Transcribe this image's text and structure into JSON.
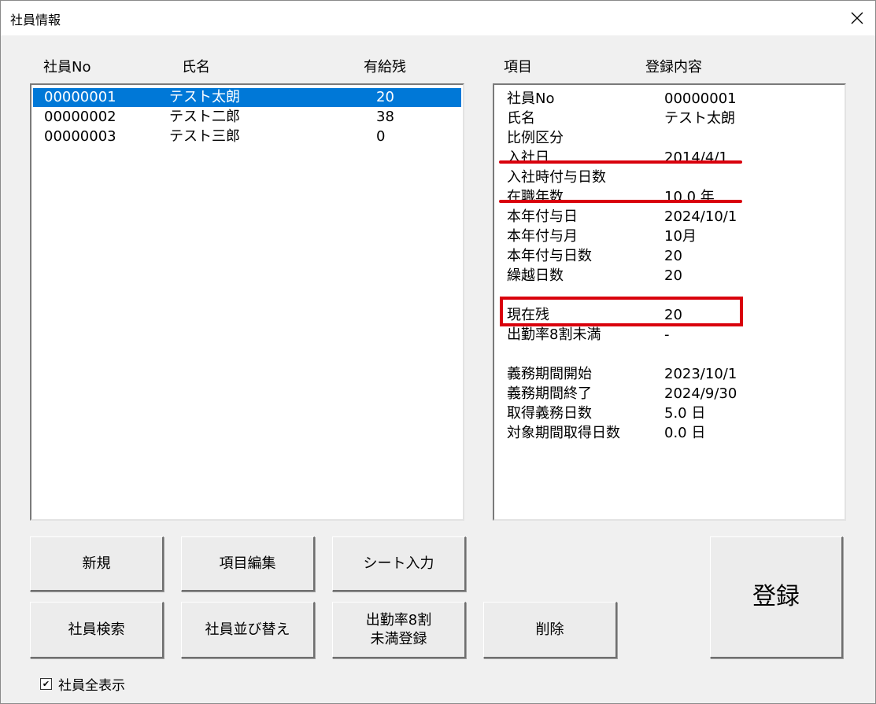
{
  "window": {
    "title": "社員情報"
  },
  "list": {
    "headers": {
      "no": "社員No",
      "name": "氏名",
      "remaining": "有給残"
    },
    "rows": [
      {
        "no": "00000001",
        "name": "テスト太朗",
        "remaining": "20",
        "selected": true
      },
      {
        "no": "00000002",
        "name": "テスト二郎",
        "remaining": "38"
      },
      {
        "no": "00000003",
        "name": "テスト三郎",
        "remaining": "0"
      }
    ]
  },
  "detail": {
    "headers": {
      "item": "項目",
      "content": "登録内容"
    },
    "rows": [
      {
        "k": "社員No",
        "v": "00000001"
      },
      {
        "k": "氏名",
        "v": "テスト太朗"
      },
      {
        "k": "比例区分",
        "v": ""
      },
      {
        "k": "入社日",
        "v": "2014/4/1"
      },
      {
        "k": "入社時付与日数",
        "v": ""
      },
      {
        "k": "在職年数",
        "v": "10.0 年"
      },
      {
        "k": "本年付与日",
        "v": "2024/10/1"
      },
      {
        "k": "本年付与月",
        "v": "10月"
      },
      {
        "k": "本年付与日数",
        "v": "20"
      },
      {
        "k": "繰越日数",
        "v": "20"
      },
      {
        "k": "",
        "v": ""
      },
      {
        "k": "現在残",
        "v": "20"
      },
      {
        "k": "出勤率8割未満",
        "v": "-"
      },
      {
        "k": "",
        "v": ""
      },
      {
        "k": "義務期間開始",
        "v": "2023/10/1"
      },
      {
        "k": "義務期間終了",
        "v": "2024/9/30"
      },
      {
        "k": "取得義務日数",
        "v": "5.0 日"
      },
      {
        "k": "対象期間取得日数",
        "v": "0.0 日"
      }
    ]
  },
  "buttons": {
    "new": "新規",
    "edit_items": "項目編集",
    "sheet_input": "シート入力",
    "search": "社員検索",
    "sort": "社員並び替え",
    "attendance": "出勤率8割\n未満登録",
    "delete": "削除",
    "register": "登録"
  },
  "show_all": {
    "label": "社員全表示",
    "checked": true,
    "mark": "✔"
  },
  "colors": {
    "selection": "#0078d7",
    "annotation": "#d9000c"
  }
}
